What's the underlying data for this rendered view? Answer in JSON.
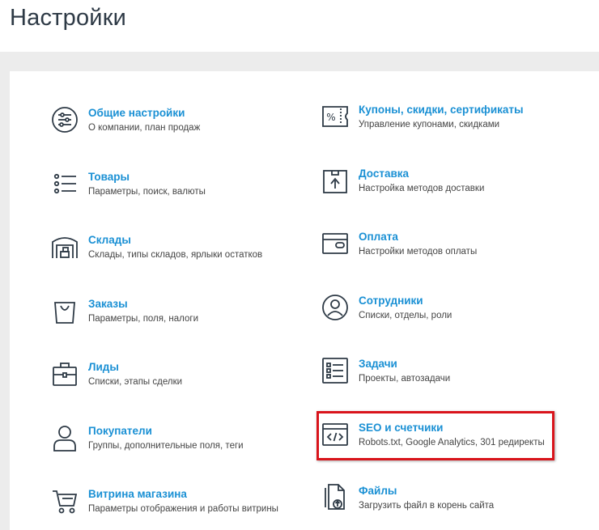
{
  "page": {
    "title": "Настройки"
  },
  "left_items": [
    {
      "title": "Общие настройки",
      "desc": "О компании, план продаж",
      "icon": "sliders-circle-icon"
    },
    {
      "title": "Товары",
      "desc": "Параметры, поиск, валюты",
      "icon": "list-icon"
    },
    {
      "title": "Склады",
      "desc": "Склады, типы складов, ярлыки остатков",
      "icon": "warehouse-icon"
    },
    {
      "title": "Заказы",
      "desc": "Параметры, поля, налоги",
      "icon": "shopping-bag-icon"
    },
    {
      "title": "Лиды",
      "desc": "Списки, этапы сделки",
      "icon": "briefcase-icon"
    },
    {
      "title": "Покупатели",
      "desc": "Группы, дополнительные поля, теги",
      "icon": "user-icon"
    },
    {
      "title": "Витрина магазина",
      "desc": "Параметры отображения и работы витрины",
      "icon": "cart-icon"
    }
  ],
  "right_items": [
    {
      "title": "Купоны, скидки, сертификаты",
      "desc": "Управление купонами, скидками",
      "icon": "coupon-icon"
    },
    {
      "title": "Доставка",
      "desc": "Настройка методов доставки",
      "icon": "box-icon"
    },
    {
      "title": "Оплата",
      "desc": "Настройки методов оплаты",
      "icon": "card-icon"
    },
    {
      "title": "Сотрудники",
      "desc": "Списки, отделы, роли",
      "icon": "person-circle-icon"
    },
    {
      "title": "Задачи",
      "desc": "Проекты, автозадачи",
      "icon": "checklist-icon"
    },
    {
      "title": "SEO и счетчики",
      "desc": "Robots.txt, Google Analytics, 301 редиректы",
      "icon": "code-window-icon"
    },
    {
      "title": "Файлы",
      "desc": "Загрузить файл в корень сайта",
      "icon": "file-upload-icon"
    }
  ],
  "colors": {
    "link": "#1a90d4",
    "icon": "#2e3a46",
    "highlight": "#d9141b",
    "band": "#ececec"
  }
}
